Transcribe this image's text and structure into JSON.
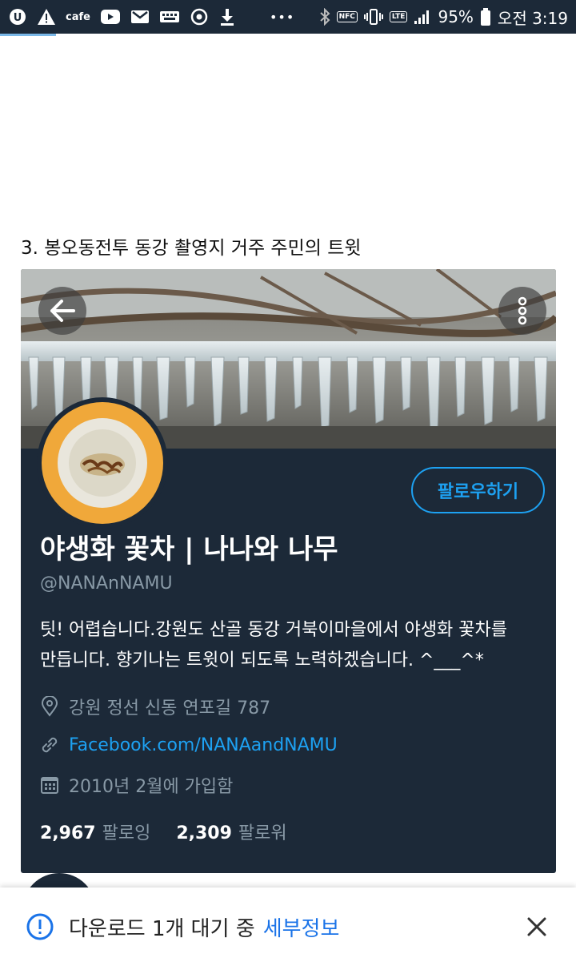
{
  "status_bar": {
    "cafe_label": "cafe",
    "dots": "•••",
    "nfc_label": "NFC",
    "lte_label": "LTE",
    "battery_percent": "95%",
    "time": "오전 3:19"
  },
  "article": {
    "heading": "3. 봉오동전투 동강 촬영지 거주 주민의 트윗"
  },
  "profile": {
    "follow_label": "팔로우하기",
    "display_name": "야생화 꽃차 | 나나와 나무",
    "handle": "@NANAnNAMU",
    "bio_line1": "팃! 어렵습니다.강원도 산골 동강 거북이마을에서 야생화 꽃차를",
    "bio_line2": "만듭니다. 향기나는 트윗이 되도록 노력하겠습니다. ^___^*",
    "location": "강원 정선 신동 연포길 787",
    "link": "Facebook.com/NANAandNAMU",
    "joined": "2010년 2월에 가입함",
    "following_count": "2,967",
    "following_label": "팔로잉",
    "followers_count": "2,309",
    "followers_label": "팔로워"
  },
  "download_bar": {
    "message": "다운로드 1개 대기 중",
    "details_label": "세부정보"
  },
  "colors": {
    "card_bg": "#1c2938",
    "accent": "#1da1f2",
    "muted": "#8899a6",
    "link_blue": "#1a73e8"
  }
}
